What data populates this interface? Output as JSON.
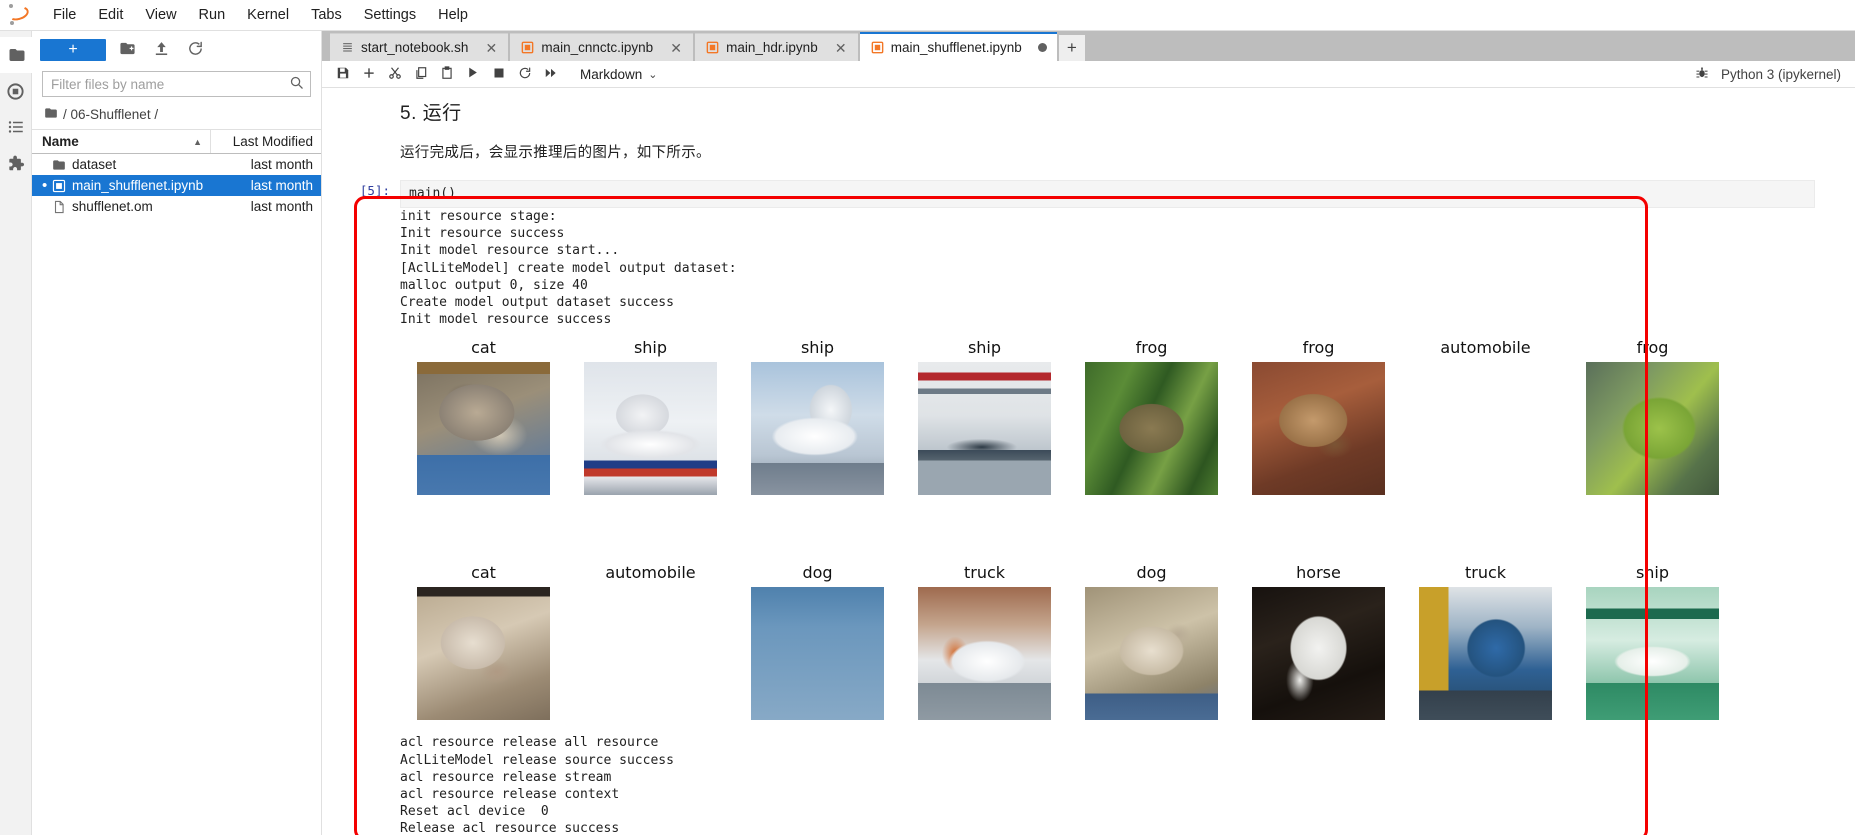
{
  "menubar": {
    "logo": "jupyter-logo",
    "items": [
      "File",
      "Edit",
      "View",
      "Run",
      "Kernel",
      "Tabs",
      "Settings",
      "Help"
    ]
  },
  "activitybar": {
    "items": [
      {
        "name": "file-browser-icon",
        "label": "Files"
      },
      {
        "name": "running-terminals-icon",
        "label": "Running Terminals and Kernels"
      },
      {
        "name": "table-of-contents-icon",
        "label": "Table of Contents"
      },
      {
        "name": "extension-manager-icon",
        "label": "Extension Manager"
      }
    ]
  },
  "filebrowser": {
    "new_launcher_label": "+",
    "new_folder_icon": "new-folder-icon",
    "upload_icon": "upload-icon",
    "refresh_icon": "refresh-icon",
    "filter_placeholder": "Filter files by name",
    "filter_value": "",
    "search_icon": "search-icon",
    "breadcrumb": "/ 06-Shufflenet /",
    "columns": [
      "Name",
      "Last Modified"
    ],
    "sort_indicator": "▲",
    "rows": [
      {
        "name": "dataset",
        "modified": "last month",
        "icon": "folder-icon",
        "selected": false,
        "dirty": false
      },
      {
        "name": "main_shufflenet.ipynb",
        "modified": "last month",
        "icon": "notebook-icon",
        "selected": true,
        "dirty": true
      },
      {
        "name": "shufflenet.om",
        "modified": "last month",
        "icon": "file-icon",
        "selected": false,
        "dirty": false
      }
    ]
  },
  "tabs": {
    "items": [
      {
        "label": "start_notebook.sh",
        "icon": "text-file-icon",
        "active": false,
        "dirty": false
      },
      {
        "label": "main_cnnctc.ipynb",
        "icon": "notebook-icon",
        "active": false,
        "dirty": false
      },
      {
        "label": "main_hdr.ipynb",
        "icon": "notebook-icon",
        "active": false,
        "dirty": false
      },
      {
        "label": "main_shufflenet.ipynb",
        "icon": "notebook-icon",
        "active": true,
        "dirty": true
      }
    ],
    "close_label": "✕",
    "add_label": "+"
  },
  "notebook_toolbar": {
    "buttons": [
      {
        "name": "save-button",
        "icon": "save-icon",
        "title": "Save"
      },
      {
        "name": "insert-cell-button",
        "icon": "plus-icon",
        "title": "Insert a cell below"
      },
      {
        "name": "cut-cell-button",
        "icon": "scissors-icon",
        "title": "Cut"
      },
      {
        "name": "copy-cell-button",
        "icon": "copy-icon",
        "title": "Copy"
      },
      {
        "name": "paste-cell-button",
        "icon": "paste-icon",
        "title": "Paste"
      },
      {
        "name": "run-cell-button",
        "icon": "play-icon",
        "title": "Run"
      },
      {
        "name": "stop-kernel-button",
        "icon": "stop-square-icon",
        "title": "Interrupt"
      },
      {
        "name": "restart-kernel-button",
        "icon": "restart-icon",
        "title": "Restart"
      },
      {
        "name": "restart-run-all-button",
        "icon": "fast-forward-icon",
        "title": "Restart and run all"
      }
    ],
    "cell_type": "Markdown",
    "cell_type_caret": "⌄",
    "kernel_status_icon": "kernel-busy-icon",
    "kernel_name": "Python 3 (ipykernel)"
  },
  "notebook": {
    "markdown_heading": "5. 运行",
    "markdown_paragraph": "运行完成后，会显示推理后的图片，如下所示。",
    "code_prompt": "[5]:",
    "code_source": "main()",
    "output_head": "init resource stage:\nInit resource success\nInit model resource start...\n[AclLiteModel] create model output dataset:\nmalloc output 0, size 40\nCreate model output dataset success\nInit model resource success",
    "output_tail": "acl resource release all resource\nAclLiteModel release source success\nacl resource release stream\nacl resource release context\nReset acl device  0\nRelease acl resource success",
    "image_rows": [
      [
        "cat",
        "ship",
        "ship",
        "ship",
        "frog",
        "frog",
        "automobile",
        "frog"
      ],
      [
        "cat",
        "automobile",
        "dog",
        "truck",
        "dog",
        "horse",
        "truck",
        "ship"
      ]
    ]
  },
  "annotation": {
    "highlight_color": "#f40000",
    "name": "red-highlight-box"
  },
  "colors": {
    "accent": "#1976d2",
    "jupyter_orange": "#f37726",
    "selected_row": "#1976d2",
    "tabbar_bg": "#bdbdbd"
  }
}
